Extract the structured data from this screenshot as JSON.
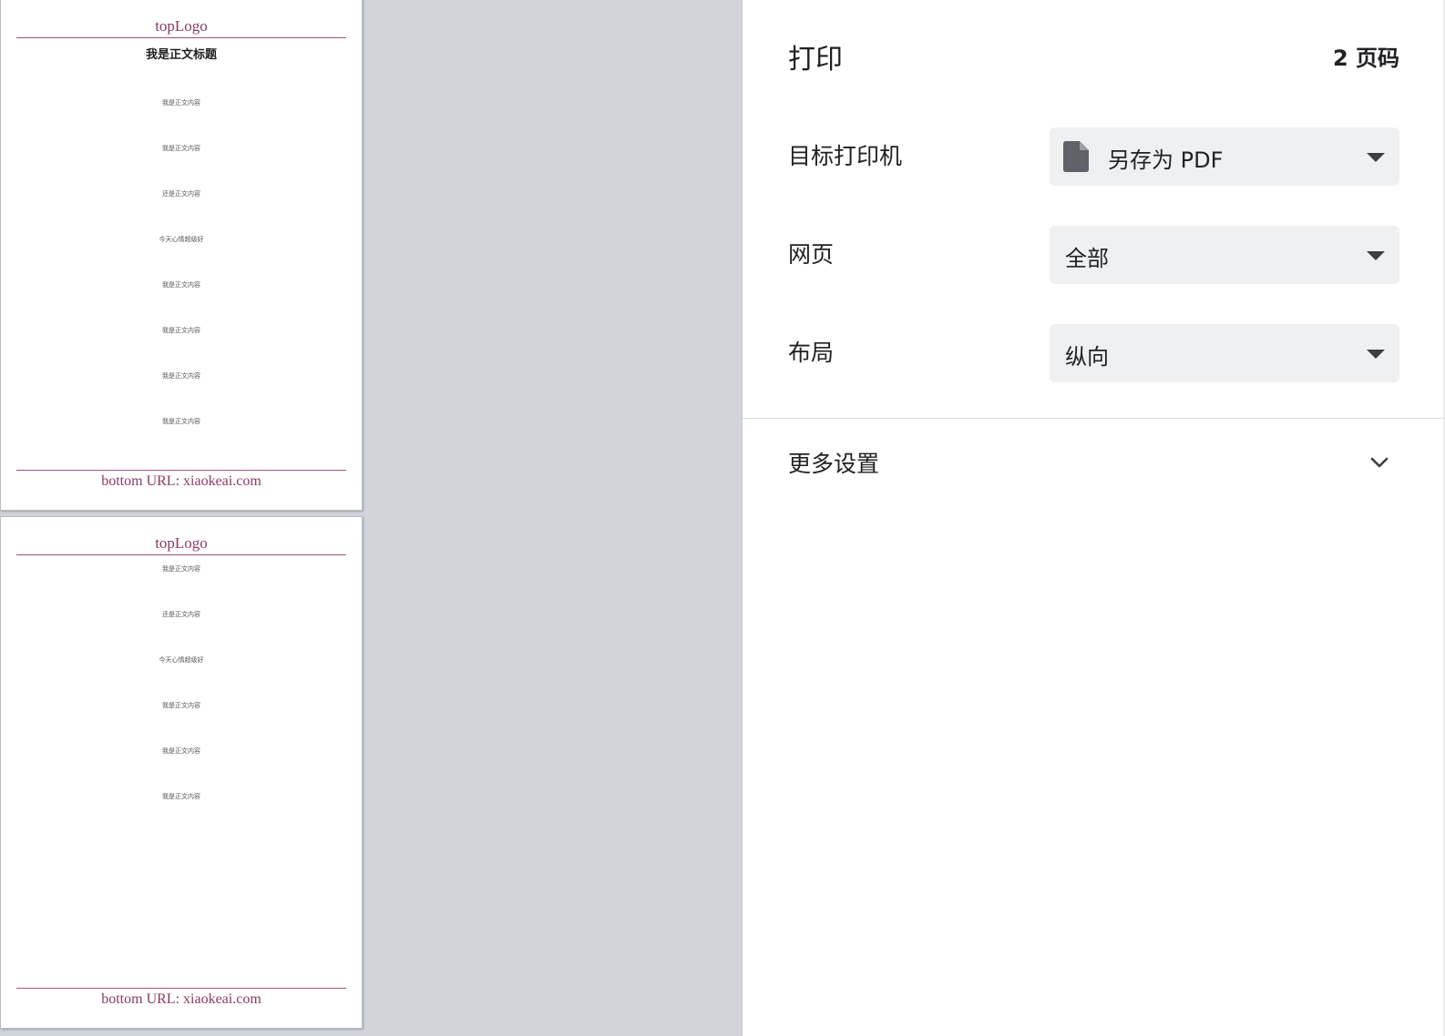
{
  "preview": {
    "pages": [
      {
        "header_logo": "topLogo",
        "doc_title": "我是正文标题",
        "lines": [
          "我是正文内容",
          "我是正文内容",
          "还是正文内容",
          "今天心情超级好",
          "我是正文内容",
          "我是正文内容",
          "我是正文内容",
          "我是正文内容"
        ],
        "footer": "bottom URL: xiaokeai.com"
      },
      {
        "header_logo": "topLogo",
        "lines": [
          "我是正文内容",
          "还是正文内容",
          "今天心情超级好",
          "我是正文内容",
          "我是正文内容",
          "我是正文内容"
        ],
        "footer": "bottom URL: xiaokeai.com"
      }
    ]
  },
  "panel": {
    "title": "打印",
    "page_count": "2 页码",
    "destination": {
      "label": "目标打印机",
      "value": "另存为 PDF",
      "icon": "document-icon"
    },
    "pages": {
      "label": "网页",
      "value": "全部"
    },
    "layout": {
      "label": "布局",
      "value": "纵向"
    },
    "more_settings": {
      "label": "更多设置",
      "icon": "chevron-down-icon"
    }
  }
}
